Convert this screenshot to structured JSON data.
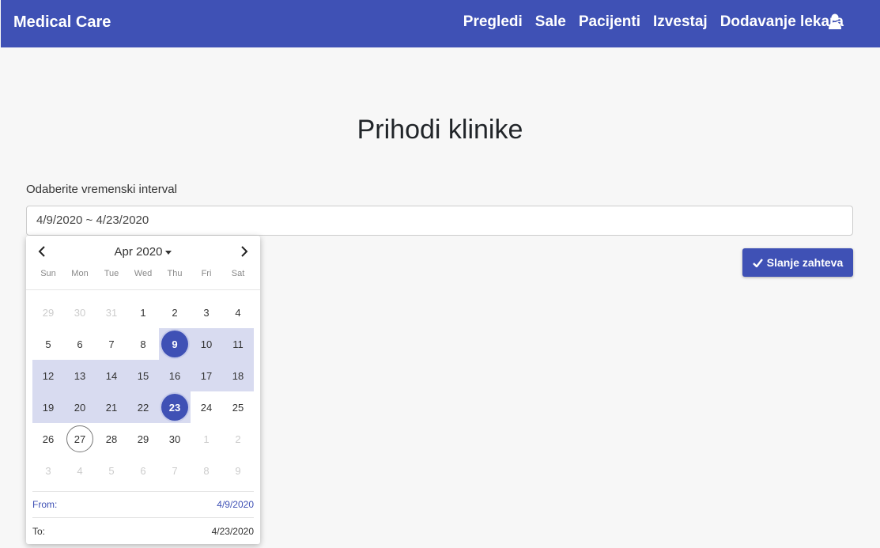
{
  "navbar": {
    "brand": "Medical Care",
    "links": [
      "Pregledi",
      "Sale",
      "Pacijenti",
      "Izvestaj",
      "Dodavanje lekara"
    ],
    "user_icon": "user-icon",
    "color": "#3f51b5"
  },
  "page": {
    "title": "Prihodi klinike",
    "field_label": "Odaberite vremenski interval",
    "date_range_value": "4/9/2020 ~ 4/23/2020",
    "submit_label": "Slanje zahteva",
    "submit_icon": "check-icon"
  },
  "calendar": {
    "month_label": "Apr 2020",
    "weekdays": [
      "Sun",
      "Mon",
      "Tue",
      "Wed",
      "Thu",
      "Fri",
      "Sat"
    ],
    "weeks": [
      [
        {
          "d": "29",
          "other": true
        },
        {
          "d": "30",
          "other": true
        },
        {
          "d": "31",
          "other": true
        },
        {
          "d": "1"
        },
        {
          "d": "2"
        },
        {
          "d": "3"
        },
        {
          "d": "4"
        }
      ],
      [
        {
          "d": "5"
        },
        {
          "d": "6"
        },
        {
          "d": "7"
        },
        {
          "d": "8"
        },
        {
          "d": "9",
          "selected": true,
          "inrange": true
        },
        {
          "d": "10",
          "inrange": true
        },
        {
          "d": "11",
          "inrange": true
        }
      ],
      [
        {
          "d": "12",
          "inrange": true
        },
        {
          "d": "13",
          "inrange": true
        },
        {
          "d": "14",
          "inrange": true
        },
        {
          "d": "15",
          "inrange": true
        },
        {
          "d": "16",
          "inrange": true
        },
        {
          "d": "17",
          "inrange": true
        },
        {
          "d": "18",
          "inrange": true
        }
      ],
      [
        {
          "d": "19",
          "inrange": true
        },
        {
          "d": "20",
          "inrange": true
        },
        {
          "d": "21",
          "inrange": true
        },
        {
          "d": "22",
          "inrange": true
        },
        {
          "d": "23",
          "selected": true,
          "inrange": true
        },
        {
          "d": "24"
        },
        {
          "d": "25"
        }
      ],
      [
        {
          "d": "26"
        },
        {
          "d": "27",
          "today": true
        },
        {
          "d": "28"
        },
        {
          "d": "29"
        },
        {
          "d": "30"
        },
        {
          "d": "1",
          "other": true
        },
        {
          "d": "2",
          "other": true
        }
      ],
      [
        {
          "d": "3",
          "other": true
        },
        {
          "d": "4",
          "other": true
        },
        {
          "d": "5",
          "other": true
        },
        {
          "d": "6",
          "other": true
        },
        {
          "d": "7",
          "other": true
        },
        {
          "d": "8",
          "other": true
        },
        {
          "d": "9",
          "other": true
        }
      ]
    ],
    "from_label": "From:",
    "from_value": "4/9/2020",
    "to_label": "To:",
    "to_value": "4/23/2020"
  }
}
